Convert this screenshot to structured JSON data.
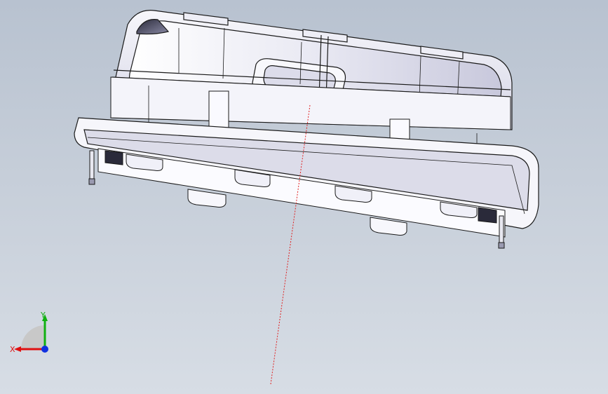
{
  "triad": {
    "x_label": "X",
    "y_label": "Y",
    "colors": {
      "x": "#e01010",
      "y": "#10b010",
      "z": "#1030e0"
    }
  },
  "colors": {
    "background_top": "#b8c2d0",
    "background_bottom": "#d7dde5",
    "part_fill": "#f3f3f8",
    "part_shade": "#cfcfe0",
    "part_edge": "#1a1a1a",
    "center_line": "#e02020"
  }
}
